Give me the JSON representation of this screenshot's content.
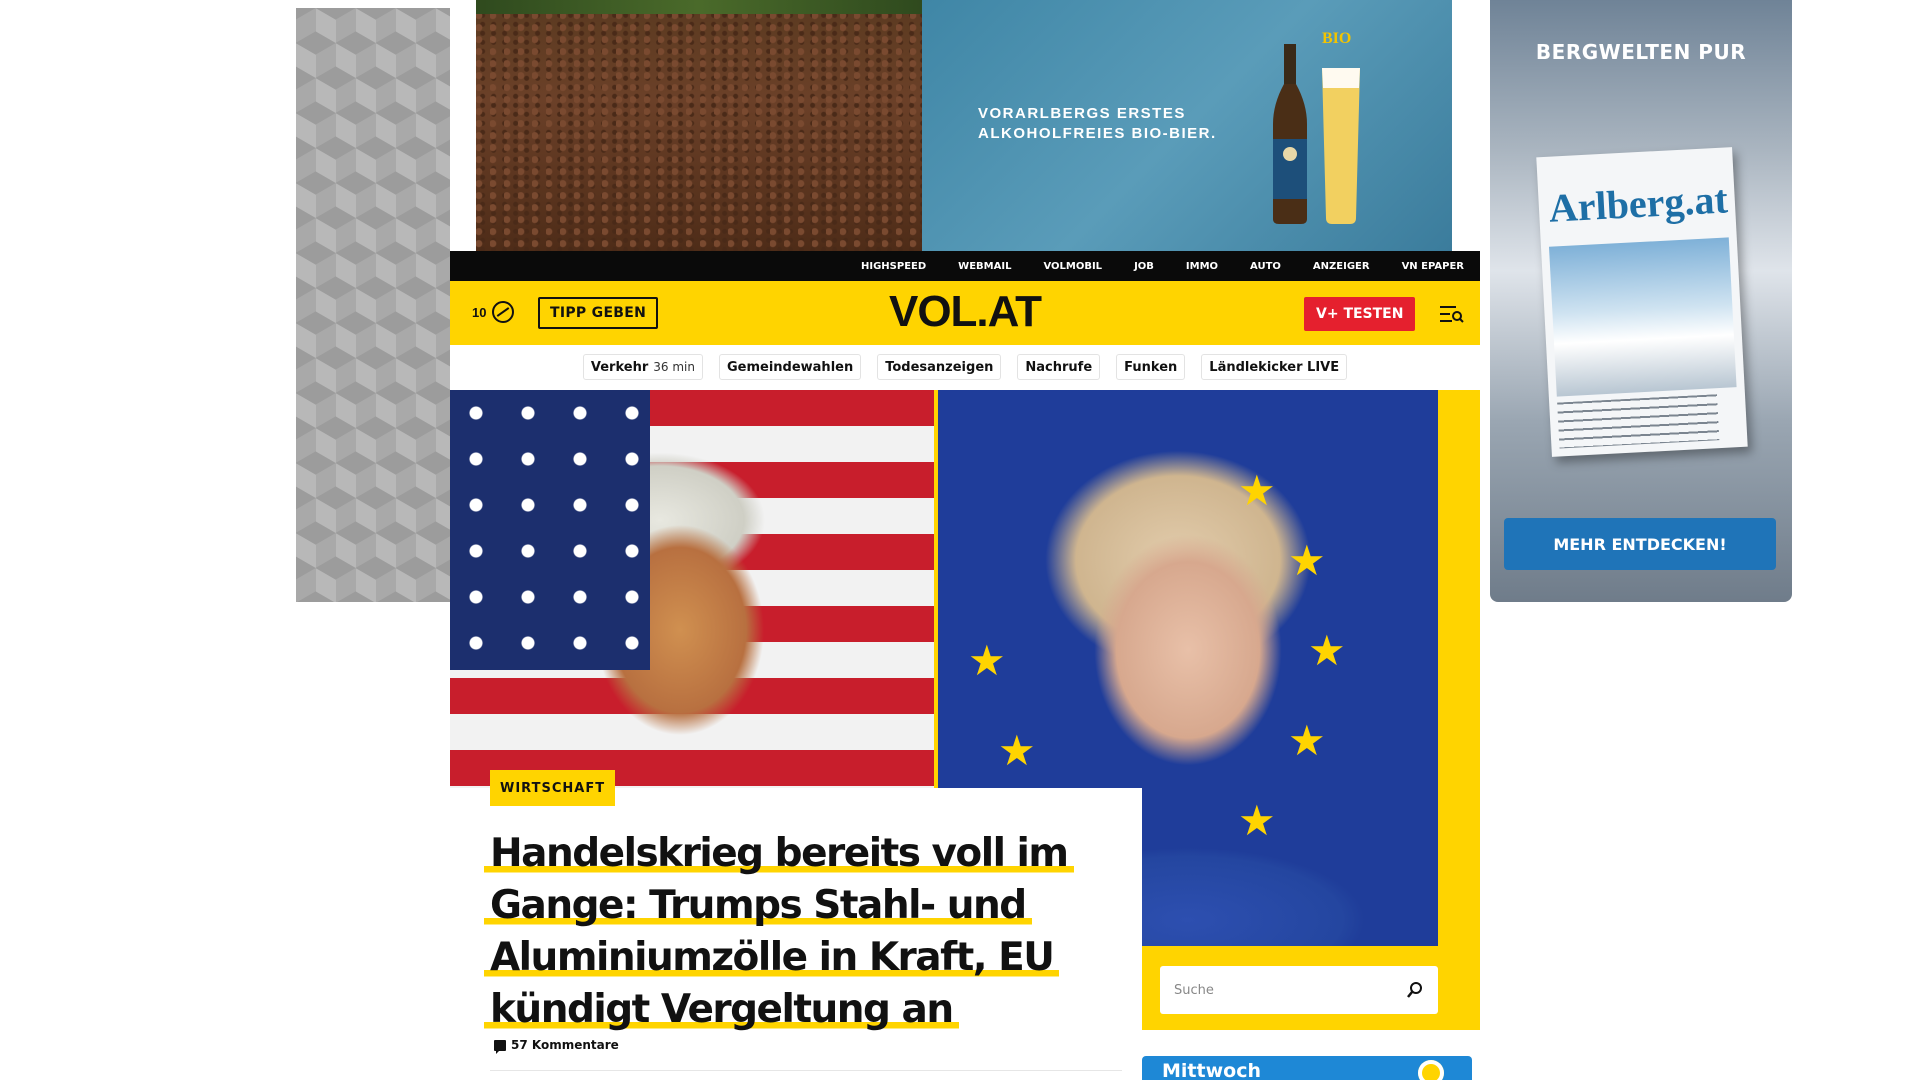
{
  "ads": {
    "top": {
      "headline_line1": "VORARLBERGS ERSTES",
      "headline_line2": "ALKOHOLFREIES BIO-BIER.",
      "bio_label": "BIO"
    },
    "right": {
      "title": "BERGWELTEN PUR",
      "magazine_title": "Arlberg.at",
      "button": "MEHR ENTDECKEN!"
    }
  },
  "topbar": {
    "links": [
      "HIGHSPEED",
      "WEBMAIL",
      "VOLMOBIL",
      "JOB",
      "IMMO",
      "AUTO",
      "ANZEIGER",
      "VN EPAPER"
    ]
  },
  "header": {
    "temperature": "10",
    "tipp_button": "TIPP GEBEN",
    "logo": "VOL.AT",
    "vplus_button": "V+ TESTEN"
  },
  "subnav": {
    "traffic_label": "Verkehr",
    "traffic_value": "36 min",
    "items": [
      "Gemeindewahlen",
      "Todesanzeigen",
      "Nachrufe",
      "Funken",
      "Ländlekicker LIVE"
    ]
  },
  "article": {
    "tag": "WIRTSCHAFT",
    "headline_lines": [
      "Handelskrieg bereits voll im",
      "Gange: Trumps Stahl- und",
      "Aluminiumzölle in Kraft, EU",
      "kündigt Vergeltung an"
    ],
    "comments": "57 Kommentare"
  },
  "search": {
    "placeholder": "Suche"
  },
  "weather": {
    "day": "Mittwoch"
  },
  "colors": {
    "brand_yellow": "#ffd400",
    "vplus_red": "#e5202e",
    "topbar_black": "#0a0a0a",
    "weather_blue": "#1e88d6"
  }
}
